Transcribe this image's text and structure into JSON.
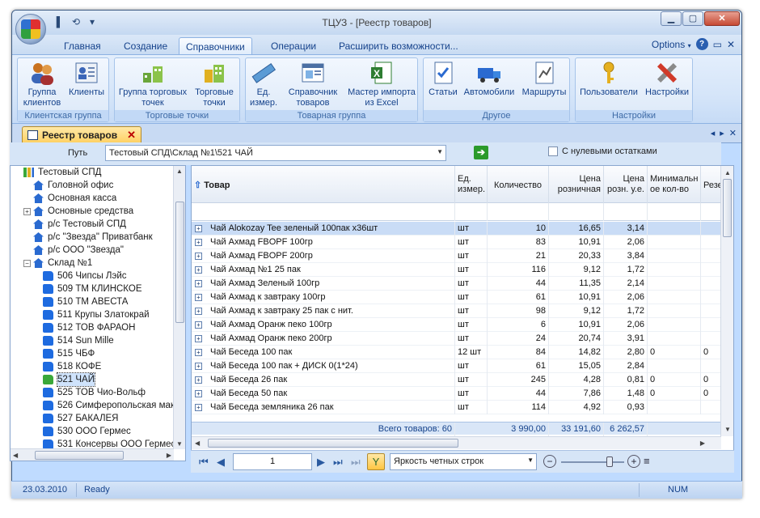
{
  "window": {
    "title": "ТЦУЗ - [Реестр товаров]",
    "min": "▁",
    "max": "▢",
    "close": "✕"
  },
  "qat": [
    "▌",
    "⟲",
    "▾"
  ],
  "tabs": {
    "items": [
      "Главная",
      "Создание",
      "Справочники",
      "Операции",
      "Расширить возможности..."
    ],
    "active": "Справочники",
    "options_label": "Options",
    "options_arrow": "▾",
    "help": "?",
    "restore": "▭",
    "close": "✕"
  },
  "ribbon": {
    "groups": [
      {
        "label": "Клиентская группа",
        "buttons": [
          "Группа клиентов",
          "Клиенты"
        ]
      },
      {
        "label": "Торговые точки",
        "buttons": [
          "Группа торговых точек",
          "Торговые точки"
        ]
      },
      {
        "label": "Товарная группа",
        "buttons": [
          "Ед. измер.",
          "Справочник товаров",
          "Мастер импорта из Excel"
        ]
      },
      {
        "label": "Другое",
        "buttons": [
          "Статьи",
          "Автомобили",
          "Маршруты"
        ]
      },
      {
        "label": "Настройки",
        "buttons": [
          "Пользователи",
          "Настройки"
        ]
      }
    ]
  },
  "doctab": {
    "label": "Реестр товаров",
    "close": "✕",
    "scroll_left": "◂",
    "scroll_right": "▸",
    "close_all": "✕"
  },
  "pathbar": {
    "label": "Путь",
    "value": "Тестовый СПД\\Склад №1\\521 ЧАЙ",
    "dropdown_arrow": "▼",
    "go": "➔",
    "zero_label": "С нулевыми остатками",
    "zero_checked": false
  },
  "tree": {
    "nodes": [
      {
        "label": "Тестовый СПД",
        "level": 0,
        "icon": "chart-icon",
        "exp": ""
      },
      {
        "label": "Головной офис",
        "level": 1,
        "icon": "house-icon",
        "exp": ""
      },
      {
        "label": "Основная касса",
        "level": 1,
        "icon": "house-icon",
        "exp": ""
      },
      {
        "label": "Основные средства",
        "level": 1,
        "icon": "house-icon",
        "exp": "+"
      },
      {
        "label": "р/с  Тестовый СПД",
        "level": 1,
        "icon": "house-icon",
        "exp": ""
      },
      {
        "label": "р/с \"Звезда\" Приватбанк",
        "level": 1,
        "icon": "house-icon",
        "exp": ""
      },
      {
        "label": "р/с ООО \"Звезда\"",
        "level": 1,
        "icon": "house-icon",
        "exp": ""
      },
      {
        "label": "Склад №1",
        "level": 1,
        "icon": "house-icon",
        "exp": "−"
      },
      {
        "label": "506 Чипсы Лэйс",
        "level": 2,
        "icon": "folder-icon",
        "exp": ""
      },
      {
        "label": "509 ТМ КЛИНСКОЕ",
        "level": 2,
        "icon": "folder-icon",
        "exp": ""
      },
      {
        "label": "510 ТМ АВЕСТА",
        "level": 2,
        "icon": "folder-icon",
        "exp": ""
      },
      {
        "label": "511 Крупы Златокрай",
        "level": 2,
        "icon": "folder-icon",
        "exp": ""
      },
      {
        "label": "512 ТОВ ФАРАОН",
        "level": 2,
        "icon": "folder-icon",
        "exp": ""
      },
      {
        "label": "514 Sun Mille",
        "level": 2,
        "icon": "folder-icon",
        "exp": ""
      },
      {
        "label": "515 ЧБФ",
        "level": 2,
        "icon": "folder-icon",
        "exp": ""
      },
      {
        "label": "518 КОФЕ",
        "level": 2,
        "icon": "folder-icon",
        "exp": ""
      },
      {
        "label": "521 ЧАЙ",
        "level": 2,
        "icon": "folder-open-icon",
        "exp": "",
        "selected": true
      },
      {
        "label": "525 ТОВ Чио-Вольф",
        "level": 2,
        "icon": "folder-icon",
        "exp": ""
      },
      {
        "label": "526 Симферопольская мак",
        "level": 2,
        "icon": "folder-icon",
        "exp": ""
      },
      {
        "label": "527 БАКАЛЕЯ",
        "level": 2,
        "icon": "folder-icon",
        "exp": ""
      },
      {
        "label": "530 ООО Гермес",
        "level": 2,
        "icon": "folder-icon",
        "exp": ""
      },
      {
        "label": "531 Консервы ООО Гермес",
        "level": 2,
        "icon": "folder-icon",
        "exp": ""
      }
    ],
    "scroll_up": "▲",
    "scroll_down": "▼",
    "scroll_left": "◀",
    "scroll_right": "▶"
  },
  "grid": {
    "sort_icon": "⇧",
    "columns": [
      "Товар",
      "Ед. измер.",
      "Количество",
      "Цена розничная",
      "Цена розн. у.е.",
      "Минимальн ое кол-во",
      "Резе"
    ],
    "rows": [
      [
        "Чай Alokozay Tee зеленый 100пак х36шт",
        "шт",
        "10",
        "16,65",
        "3,14",
        "",
        ""
      ],
      [
        "Чай Ахмад FBOPF 100гр",
        "шт",
        "83",
        "10,91",
        "2,06",
        "",
        ""
      ],
      [
        "Чай Ахмад FBOPF 200гр",
        "шт",
        "21",
        "20,33",
        "3,84",
        "",
        ""
      ],
      [
        "Чай Ахмад №1 25 пак",
        "шт",
        "116",
        "9,12",
        "1,72",
        "",
        ""
      ],
      [
        "Чай Ахмад Зеленый 100гр",
        "шт",
        "44",
        "11,35",
        "2,14",
        "",
        ""
      ],
      [
        "Чай Ахмад к завтраку 100гр",
        "шт",
        "61",
        "10,91",
        "2,06",
        "",
        ""
      ],
      [
        "Чай Ахмад к завтраку 25 пак с нит.",
        "шт",
        "98",
        "9,12",
        "1,72",
        "",
        ""
      ],
      [
        "Чай Ахмад Оранж пеко 100гр",
        "шт",
        "6",
        "10,91",
        "2,06",
        "",
        ""
      ],
      [
        "Чай Ахмад Оранж пеко 200гр",
        "шт",
        "24",
        "20,74",
        "3,91",
        "",
        ""
      ],
      [
        "Чай Беседа 100 пак",
        "12 шт",
        "84",
        "14,82",
        "2,80",
        "0",
        "0"
      ],
      [
        "Чай Беседа 100 пак + ДИСК 0(1*24)",
        "шт",
        "61",
        "15,05",
        "2,84",
        "",
        ""
      ],
      [
        "Чай Беседа 26 пак",
        "шт",
        "245",
        "4,28",
        "0,81",
        "0",
        "0"
      ],
      [
        "Чай Беседа 50 пак",
        "шт",
        "44",
        "7,86",
        "1,48",
        "0",
        "0"
      ],
      [
        "Чай Беседа земляника 26 пак",
        "шт",
        "114",
        "4,92",
        "0,93",
        "",
        ""
      ]
    ],
    "row_expander": "+",
    "footer": {
      "total_label": "Всего товаров: 60",
      "qty": "3 990,00",
      "retail": "33 191,60",
      "retail_ue": "6 262,57"
    },
    "scroll_up": "▲",
    "scroll_down": "▼",
    "scroll_left": "◀",
    "scroll_right": "▶"
  },
  "navbar": {
    "first": "⏮",
    "prev": "◀",
    "page": "1",
    "next": "▶",
    "last": "⏭",
    "end": "⏭",
    "filter": "Y",
    "style_value": "Яркость четных строк",
    "style_arrow": "▼",
    "zoom_minus": "−",
    "zoom_plus": "+",
    "zoom_menu": "≡"
  },
  "status": {
    "date": "23.03.2010",
    "state": "Ready",
    "num": "NUM"
  }
}
